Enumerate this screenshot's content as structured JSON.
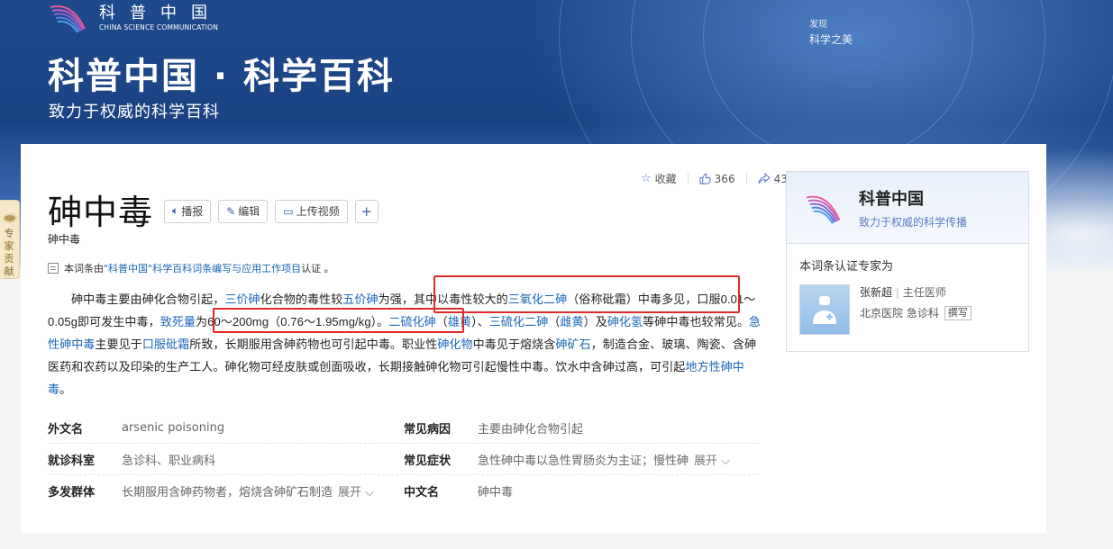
{
  "banner": {
    "logo_cn": "科普中国",
    "logo_en": "CHINA SCIENCE COMMUNICATION",
    "title": "科普中国 · 科学百科",
    "subtitle": "致力于权威的科学百科",
    "discover_label": "发现",
    "discover_title": "科学之美"
  },
  "side_tab": {
    "text": "专家贡献"
  },
  "entry": {
    "title": "砷中毒",
    "subtitle": "砷中毒",
    "buttons": {
      "broadcast": "播报",
      "edit": "编辑",
      "upload_video": "上传视频",
      "add": "+"
    },
    "actions": {
      "collect": "收藏",
      "likes": "366",
      "shares": "43"
    },
    "certification": {
      "prefix": "本词条由",
      "project": "\"科普中国\"科学百科词条编写与应用工作项目",
      "suffix": " 认证 。"
    },
    "paragraph": {
      "s1": "砷中毒主要由砷化合物引起，",
      "l1": "三价砷",
      "s2": "化合物的毒性较",
      "l2": "五价砷",
      "s3": "为强，其中以毒性较大的",
      "l3": "三氧化二砷",
      "s4": "（俗称砒霜）中毒多见，口服0.01～0.05g即可发生中毒，",
      "l4": "致死量",
      "s5": "为60～200mg（0.76～1.95mg/kg）。",
      "l5": "二硫化砷",
      "s6": "（",
      "l6": "雄黄",
      "s7": "）、",
      "l7": "三硫化二砷",
      "s8": "（",
      "l8": "雌黄",
      "s9": "）及",
      "l9": "砷化氢",
      "s10": "等砷中毒也较常见。",
      "l10": "急性砷中毒",
      "s11": "主要见于",
      "l11": "口服砒霜",
      "s12": "所致，长期服用含砷药物也可引起中毒。职业性",
      "l12": "砷化物",
      "s13": "中毒见于熔烧含",
      "l13": "砷矿石",
      "s14": "，制造合金、玻璃、陶瓷、含砷医药和农药以及印染的生产工人。砷化物可经皮肤或创面吸收，长期接触砷化物可引起慢性中毒。饮水中含砷过高，可引起",
      "l14": "地方性砷中毒",
      "s15": "。"
    },
    "info": {
      "foreign_name_label": "外文名",
      "foreign_name": "arsenic poisoning",
      "common_cause_label": "常见病因",
      "common_cause": "主要由砷化合物引起",
      "dept_label": "就诊科室",
      "dept": "急诊科、职业病科",
      "symptom_label": "常见症状",
      "symptom": "急性砷中毒以急性胃肠炎为主证；慢性砷",
      "group_label": "多发群体",
      "group": "长期服用含砷药物者，熔烧含砷矿石制造",
      "cn_name_label": "中文名",
      "cn_name": "砷中毒",
      "expand": "展开"
    }
  },
  "panel": {
    "title": "科普中国",
    "subtitle": "致力于权威的科学传播",
    "expert_label": "本词条认证专家为",
    "expert_name": "张新超",
    "expert_role": "主任医师",
    "expert_org": "北京医院 急诊科",
    "expert_tag": "撰写"
  },
  "colors": {
    "link": "#1b66b8",
    "highlight_box": "#e02a2a",
    "banner": "#1e4a8c"
  }
}
